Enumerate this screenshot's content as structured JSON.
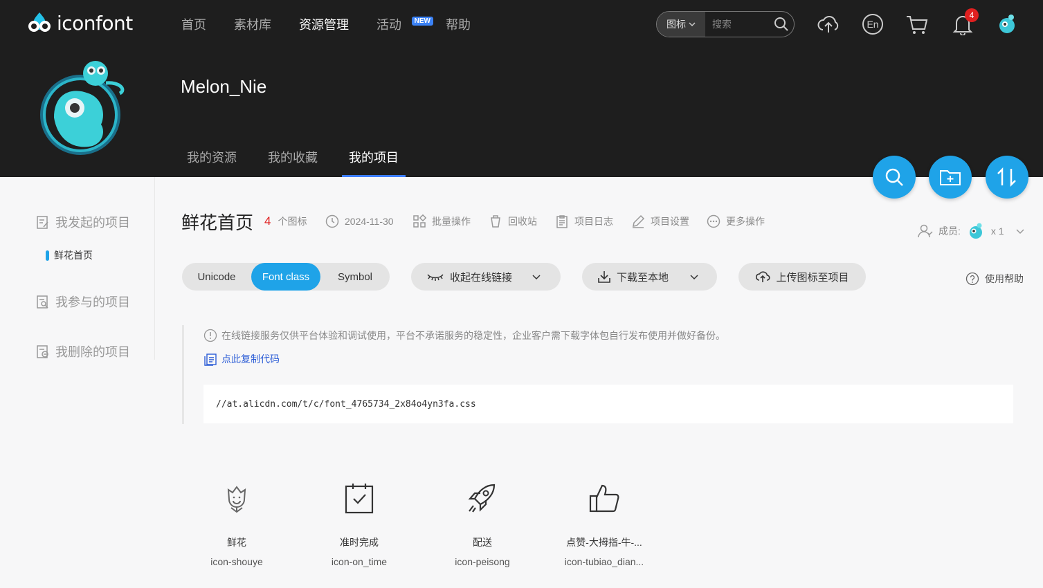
{
  "header": {
    "logo_text": "iconfont",
    "nav": [
      {
        "label": "首页"
      },
      {
        "label": "素材库"
      },
      {
        "label": "资源管理"
      },
      {
        "label": "活动",
        "badge": "NEW"
      },
      {
        "label": "帮助"
      }
    ],
    "search": {
      "type_label": "图标",
      "placeholder": "搜索"
    },
    "notifications_count": "4",
    "colors": {
      "accent": "#1fa3e8",
      "header_bg": "#1e1e1e",
      "badge_red": "#e02020"
    }
  },
  "profile": {
    "username": "Melon_Nie",
    "tabs": [
      {
        "label": "我的资源"
      },
      {
        "label": "我的收藏"
      },
      {
        "label": "我的项目"
      }
    ]
  },
  "sidebar": {
    "sections": [
      {
        "label": "我发起的项目"
      },
      {
        "label": "我参与的项目"
      },
      {
        "label": "我删除的项目"
      }
    ],
    "current_project": "鲜花首页"
  },
  "project": {
    "title": "鲜花首页",
    "icon_count": "4",
    "icon_count_suffix": "个图标",
    "date": "2024-11-30",
    "batch_label": "批量操作",
    "recycle_label": "回收站",
    "log_label": "项目日志",
    "settings_label": "项目设置",
    "more_label": "更多操作",
    "members_label": "成员:",
    "members_count": "x 1"
  },
  "toolbar": {
    "segments": [
      {
        "label": "Unicode"
      },
      {
        "label": "Font class"
      },
      {
        "label": "Symbol"
      }
    ],
    "collapse_label": "收起在线链接",
    "download_label": "下载至本地",
    "upload_label": "上传图标至项目",
    "help_label": "使用帮助"
  },
  "link_panel": {
    "notice": "在线链接服务仅供平台体验和调试使用，平台不承诺服务的稳定性，企业客户需下载字体包自行发布使用并做好备份。",
    "copy_label": "点此复制代码",
    "url": "//at.alicdn.com/t/c/font_4765734_2x84o4yn3fa.css"
  },
  "icons": [
    {
      "name": "鲜花",
      "code": "icon-shouye",
      "glyph": "flower-icon"
    },
    {
      "name": "准时完成",
      "code": "icon-on_time",
      "glyph": "calendar-check-icon"
    },
    {
      "name": "配送",
      "code": "icon-peisong",
      "glyph": "rocket-icon"
    },
    {
      "name": "点赞-大拇指-牛-...",
      "code": "icon-tubiao_dian...",
      "glyph": "thumbs-up-icon"
    }
  ]
}
